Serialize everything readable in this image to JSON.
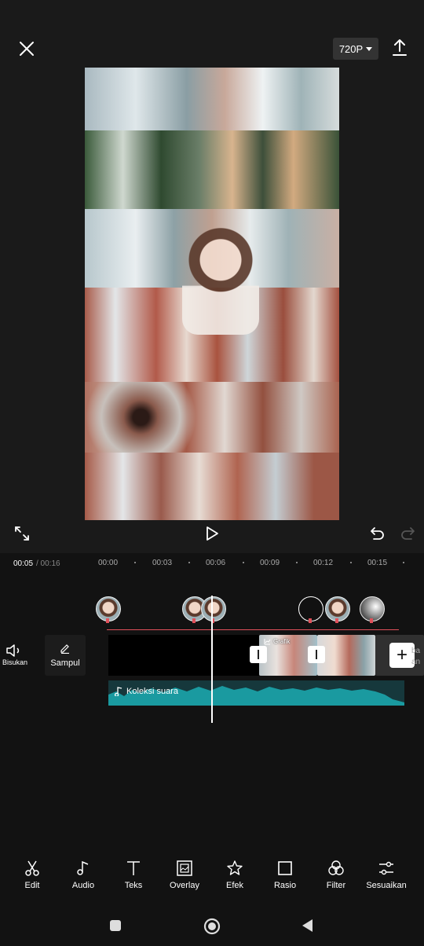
{
  "header": {
    "resolution": "720P"
  },
  "playback": {
    "current_time": "00:05",
    "total_time": "/ 00:16",
    "ticks": [
      "00:00",
      "00:03",
      "00:06",
      "00:09",
      "00:12",
      "00:15"
    ]
  },
  "timeline": {
    "mute_label": "Bisukan",
    "cover_label": "Sampul",
    "clip_label": "Grafik",
    "audio_label": "Koleksi suara",
    "side_text": "ba\nan"
  },
  "toolbar": {
    "items": [
      {
        "label": "Edit",
        "icon": "scissors-icon"
      },
      {
        "label": "Audio",
        "icon": "music-note-icon"
      },
      {
        "label": "Teks",
        "icon": "text-icon"
      },
      {
        "label": "Overlay",
        "icon": "overlay-icon"
      },
      {
        "label": "Efek",
        "icon": "sparkle-star-icon"
      },
      {
        "label": "Rasio",
        "icon": "square-icon"
      },
      {
        "label": "Filter",
        "icon": "filter-circles-icon"
      },
      {
        "label": "Sesuaikan",
        "icon": "sliders-icon"
      }
    ]
  },
  "colors": {
    "background": "#121212",
    "accent_red": "#e0505a",
    "audio_track": "#16383c",
    "waveform": "#1a9aa0"
  }
}
